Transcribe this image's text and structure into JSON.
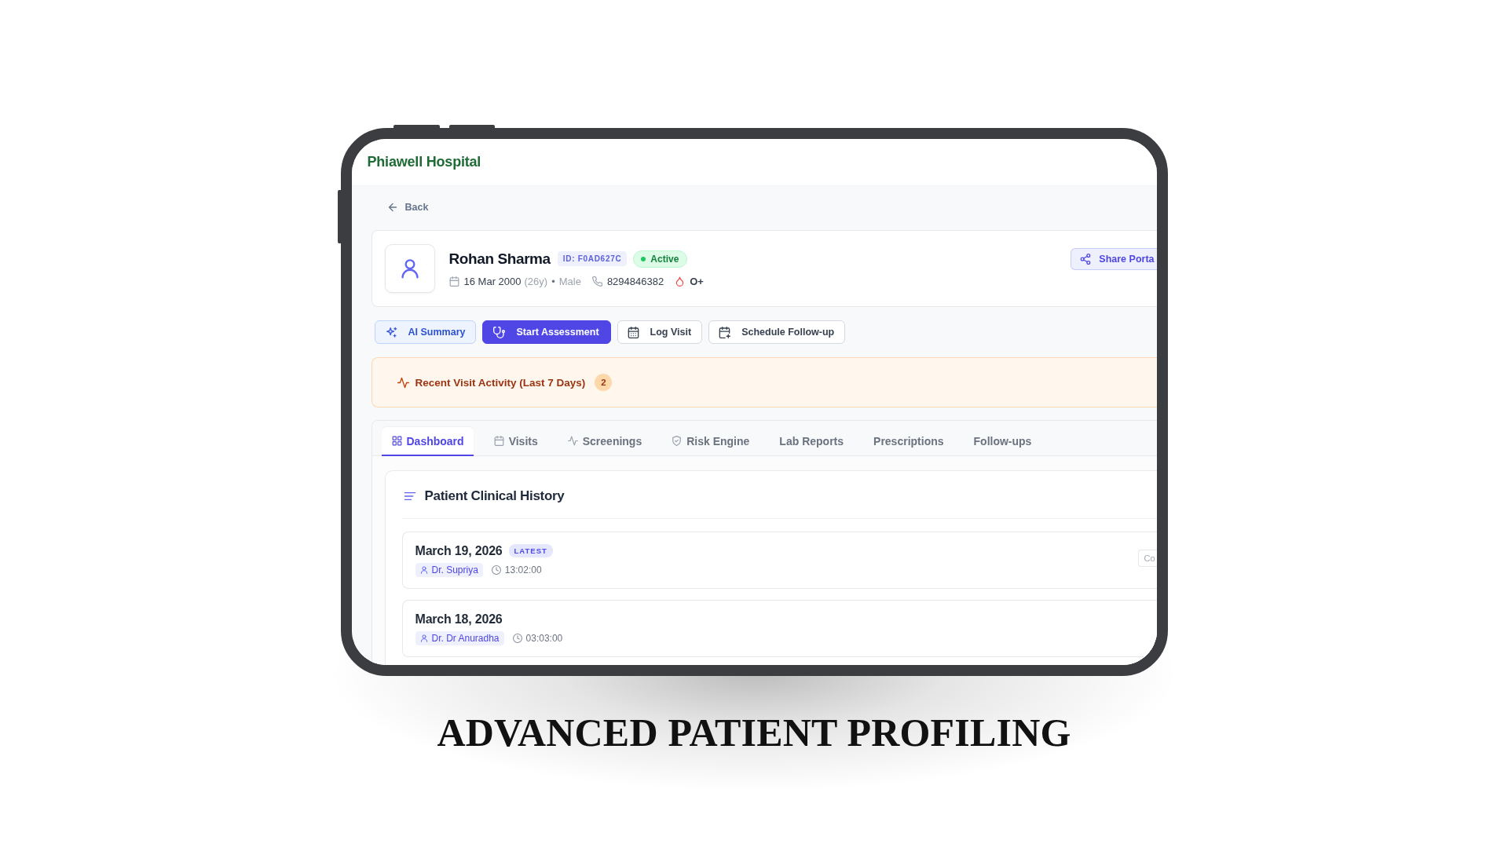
{
  "hospital": {
    "name": "Phiawell Hospital"
  },
  "back": {
    "label": "Back"
  },
  "patient": {
    "name": "Rohan Sharma",
    "id_badge": "ID: F0AD627C",
    "status": "Active",
    "birth_date": "16 Mar 2000",
    "age": "(26y)",
    "separator": "•",
    "gender": "Male",
    "phone": "8294846382",
    "blood_group": "O+",
    "share_button": "Share Porta"
  },
  "actions": [
    {
      "kind": "summary",
      "label": "AI Summary"
    },
    {
      "kind": "assessment",
      "label": "Start Assessment"
    },
    {
      "kind": "log",
      "label": "Log Visit"
    },
    {
      "kind": "schedule",
      "label": "Schedule Follow-up"
    }
  ],
  "activity_banner": {
    "label": "Recent Visit Activity (Last 7 Days)",
    "count": "2"
  },
  "tabs": [
    {
      "kind": "dashboard",
      "label": "Dashboard",
      "selected": true
    },
    {
      "kind": "visits",
      "label": "Visits",
      "selected": false
    },
    {
      "kind": "screenings",
      "label": "Screenings",
      "selected": false
    },
    {
      "kind": "risk",
      "label": "Risk Engine",
      "selected": false
    },
    {
      "kind": "lab",
      "label": "Lab Reports",
      "selected": false
    },
    {
      "kind": "prescriptions",
      "label": "Prescriptions",
      "selected": false
    },
    {
      "kind": "followups",
      "label": "Follow-ups",
      "selected": false
    }
  ],
  "clinical_history": {
    "title": "Patient Clinical History",
    "visits": [
      {
        "date": "March 19, 2026",
        "badge": "LATEST",
        "doctor": "Dr. Supriya",
        "time": "13:02:00",
        "action": "Co"
      },
      {
        "date": "March 18, 2026",
        "doctor": "Dr. Dr Anuradha",
        "time": "03:03:00"
      }
    ]
  },
  "caption": "ADVANCED PATIENT PROFILING"
}
